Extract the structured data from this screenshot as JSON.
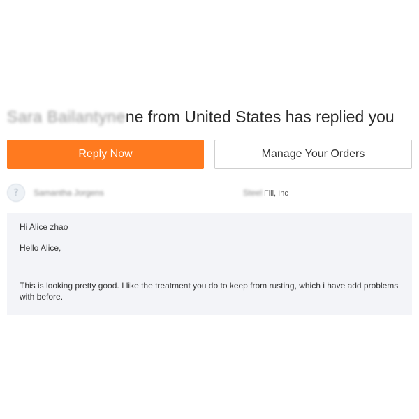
{
  "header": {
    "sender_name_redacted": "Sara Bailantyne",
    "headline_suffix": "ne from United States has replied you"
  },
  "actions": {
    "reply_label": "Reply Now",
    "manage_label": "Manage Your Orders"
  },
  "sender": {
    "avatar_glyph": "?",
    "name_redacted": "Samantha Jorgens",
    "company_redacted": "Steel",
    "company_suffix": "Fill, Inc"
  },
  "message": {
    "greeting": "Hi Alice zhao",
    "salutation": "Hello Alice,",
    "body": "This is looking pretty good. I like the treatment you do to keep from rusting, which i have add problems with before."
  },
  "colors": {
    "accent": "#ff7a1f",
    "message_bg": "#f3f4f8"
  }
}
